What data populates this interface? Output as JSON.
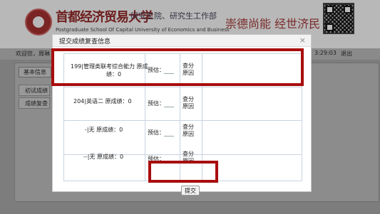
{
  "banner": {
    "university_name": "首都经济贸易大学",
    "department": "研究生院、研究生工作部",
    "university_en": "Postgraduate School Of Capital University of Economics and Business",
    "slogan": "崇德尚能  经世济民"
  },
  "topbar": {
    "welcome": "欢迎您，周琳",
    "time": "3:29:03",
    "logout": "退出"
  },
  "background": {
    "tab": "基本信息",
    "rows": [
      "初试成绩",
      "成绩复查"
    ]
  },
  "modal": {
    "title": "提交成绩复查信息",
    "close": "×",
    "rows": [
      {
        "course_line1": "199|管理类联考综合能力  原成",
        "course_line2": "绩：0",
        "estimate_label": "预估：",
        "reason_line1": "查分",
        "reason_line2": "原因"
      },
      {
        "course_line1": "204|英语二  原成绩：0",
        "course_line2": "",
        "estimate_label": "预估：",
        "reason_line1": "查分",
        "reason_line2": "原因"
      },
      {
        "course_line1": "-|无  原成绩：0",
        "course_line2": "",
        "estimate_label": "预估：",
        "reason_line1": "查分",
        "reason_line2": "原因"
      },
      {
        "course_line1": "--|无  原成绩：0",
        "course_line2": "",
        "estimate_label": "预估：",
        "reason_line1": "查分",
        "reason_line2": "原因"
      }
    ],
    "submit_label": "提交"
  },
  "colors": {
    "highlight": "#a80d0d",
    "overlay": "#7d7d7d",
    "grid_line": "#c9d3e0"
  }
}
